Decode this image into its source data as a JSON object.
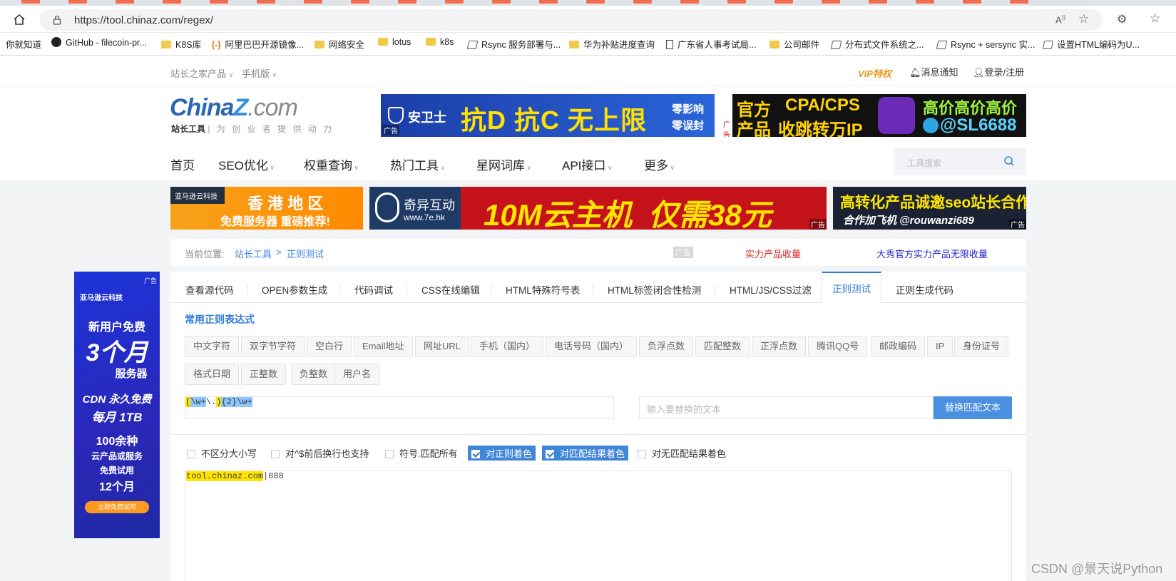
{
  "browser": {
    "url": "https://tool.chinaz.com/regex/",
    "bookmarks": [
      "你就知道",
      "GitHub - filecoin-pr...",
      "K8S库",
      "阿里巴巴开源镜像...",
      "网络安全",
      "lotus",
      "k8s",
      "Rsync 服务部署与...",
      "华为补贴进度查询",
      "广东省人事考试局...",
      "公司邮件",
      "分布式文件系统之...",
      "Rsync + sersync 实...",
      "设置HTML编码为U..."
    ]
  },
  "topbar": {
    "products": "站长之家产品",
    "mobile": "手机版",
    "vip": "VIP特权",
    "notify": "消息通知",
    "login": "登录/注册"
  },
  "logo": {
    "main_a": "China",
    "main_b": "Z",
    "main_c": ".com",
    "sub": "站长工具",
    "slogan": "| 为 创 业 者 提 供 动 力"
  },
  "ads": {
    "banner1_brand": "安卫士",
    "banner1_text": "抗D 抗C 无上限",
    "banner1_side1": "零影响",
    "banner1_side2": "零误封",
    "banner2_a": "官方",
    "banner2_b": "产品",
    "banner2_c": "CPA/CPS",
    "banner2_d": "收跳转万IP",
    "banner2_e": "高价高价高价",
    "banner2_f": "@SL6688",
    "amazon_brand": "亚马逊云科技",
    "amazon_title": "香 港 地 区",
    "amazon_sub": "免费服务器 重磅推荐!",
    "qiyi_brand": "奇异互动",
    "qiyi_site": "www.7e.hk",
    "qiyi_text": "10M云主机  仅需38元",
    "seo_title": "高转化产品诚邀seo站长合作",
    "seo_sub": "合作加飞机 @rouwanzi689",
    "ad_label": "广告",
    "side_brand": "亚马逊云科技",
    "side_1": "新用户免费",
    "side_2": "3个月",
    "side_3": "服务器",
    "side_4": "CDN 永久免费",
    "side_5": "每月 1TB",
    "side_6": "100余种",
    "side_7": "云产品或服务",
    "side_8": "免费试用",
    "side_9": "12个月",
    "side_btn": "立即免费试用"
  },
  "nav": [
    "首页",
    "SEO优化",
    "权重查询",
    "热门工具",
    "星网词库",
    "API接口",
    "更多"
  ],
  "search": {
    "placeholder": "工具搜索"
  },
  "breadcrumb": {
    "label": "当前位置:",
    "root": "站长工具",
    "sep": ">",
    "current": "正则测试",
    "ad_label": "广告",
    "ad_link1": "实力产品收量",
    "ad_link2": "大秀官方实力产品无限收量"
  },
  "tabs": [
    "查看源代码",
    "OPEN参数生成",
    "代码调试",
    "CSS在线编辑",
    "HTML特殊符号表",
    "HTML标签闭合性检测",
    "HTML/JS/CSS过滤",
    "正则测试",
    "正则生成代码"
  ],
  "common": {
    "title": "常用正则表达式",
    "row1": [
      "中文字符",
      "双字节字符",
      "空白行",
      "Email地址",
      "网址URL",
      "手机（国内）",
      "电话号码（国内）",
      "负浮点数",
      "匹配整数",
      "正浮点数",
      "腾讯QQ号",
      "邮政编码",
      "IP",
      "身份证号"
    ],
    "row2": [
      "格式日期",
      "正整数",
      "负整数",
      "用户名"
    ]
  },
  "regex": {
    "p1": "(",
    "p2": "\\w+",
    "p3": "\\.",
    "p4": ")",
    "p5": "{2}",
    "p6": "\\w+"
  },
  "replace": {
    "placeholder": "输入要替换的文本",
    "button": "替换匹配文本"
  },
  "options": [
    {
      "label": "不区分大小写",
      "checked": false
    },
    {
      "label": "对^$前后换行也支持",
      "checked": false
    },
    {
      "label": "符号.匹配所有",
      "checked": false
    },
    {
      "label": "对正则着色",
      "checked": true
    },
    {
      "label": "对匹配结果着色",
      "checked": true
    },
    {
      "label": "对无匹配结果着色",
      "checked": false
    }
  ],
  "test_text": {
    "match": "tool.chinaz.com",
    "rest": "|888"
  },
  "watermark": "CSDN @景天说Python"
}
